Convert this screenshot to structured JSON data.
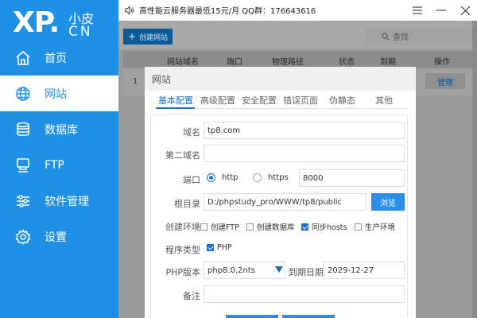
{
  "logo": {
    "main": "XP.",
    "top": "小皮",
    "bottom": "CN"
  },
  "sidebar": {
    "items": [
      {
        "label": "首页",
        "icon": "home-icon"
      },
      {
        "label": "网站",
        "icon": "globe-icon"
      },
      {
        "label": "数据库",
        "icon": "database-icon"
      },
      {
        "label": "FTP",
        "icon": "ftp-icon"
      },
      {
        "label": "软件管理",
        "icon": "settings-sliders-icon"
      },
      {
        "label": "设置",
        "icon": "gear-icon"
      }
    ],
    "active_index": 1
  },
  "topbar": {
    "ad_text": "高性能云服务器最低15元/月  QQ群：176643616"
  },
  "toolbar": {
    "new_site_label": "创建网站",
    "search_placeholder": "查找"
  },
  "table": {
    "headers": [
      "网站域名",
      "端口",
      "物理路径",
      "状态",
      "到期",
      "操作"
    ],
    "rows": [
      {
        "num": "1",
        "manage": "管理"
      }
    ]
  },
  "dialog": {
    "title": "网站",
    "tabs": [
      "基本配置",
      "高级配置",
      "安全配置",
      "错误页面",
      "伪静态",
      "其他"
    ],
    "active_tab": 0,
    "fields": {
      "domain_label": "域名",
      "domain_value": "tp8.com",
      "second_domain_label": "第二域名",
      "second_domain_value": "",
      "port_label": "端口",
      "port_http": "http",
      "port_https": "https",
      "port_value": "8000",
      "root_label": "根目录",
      "root_value": "D:/phpstudy_pro/WWW/tp8/public",
      "browse_label": "浏览",
      "env_label": "创建环境",
      "env_options": [
        {
          "label": "创建FTP",
          "checked": false
        },
        {
          "label": "创建数据库",
          "checked": false
        },
        {
          "label": "同步hosts",
          "checked": true
        },
        {
          "label": "生产环境",
          "checked": false
        }
      ],
      "program_label": "程序类型",
      "program_php": "PHP",
      "php_version_label": "PHP版本",
      "php_version_value": "php8.0.2nts",
      "expire_label": "到期日期",
      "expire_value": "2029-12-27",
      "note_label": "备注",
      "note_value": ""
    }
  },
  "colors": {
    "sidebar": "#1e90e6",
    "accent": "#1a73c8",
    "button": "#2c8ee6"
  }
}
